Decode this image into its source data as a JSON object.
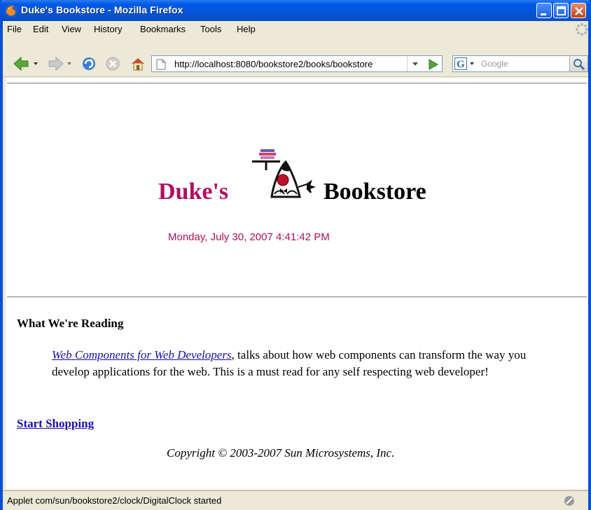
{
  "window": {
    "title": "Duke's Bookstore - Mozilla Firefox"
  },
  "menu": {
    "items": [
      "File",
      "Edit",
      "View",
      "History",
      "Bookmarks",
      "Tools",
      "Help"
    ]
  },
  "nav": {
    "url": "http://localhost:8080/bookstore2/books/bookstore",
    "search_placeholder": "Google"
  },
  "page": {
    "logo_left": "Duke's",
    "logo_right": "Bookstore",
    "clock": "Monday, July 30, 2007 4:41:42 PM",
    "reading_heading": "What We're Reading",
    "reading_link": "Web Components for Web Developers",
    "reading_text": ", talks about how web components can transform the way you develop applications for the web. This is a must read for any self respecting web developer!",
    "shop_link": "Start Shopping",
    "copyright": "Copyright © 2003-2007 Sun Microsystems, Inc."
  },
  "status": {
    "text": "Applet com/sun/bookstore2/clock/DigitalClock started"
  },
  "colors": {
    "titlebar": "#0058e6",
    "brand": "#b01060",
    "link": "#1a0dab"
  }
}
